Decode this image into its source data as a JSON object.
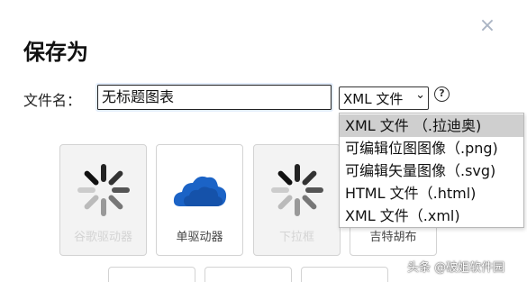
{
  "dialog": {
    "title": "保存为",
    "close_symbol": "×",
    "filename_label": "文件名：",
    "filename_value": "无标题图表",
    "format_selected": "XML 文件",
    "help_symbol": "?"
  },
  "format_options": [
    "XML 文件 （.拉迪奥)",
    "可编辑位图图像（.png)",
    "可编辑矢量图像（.svg)",
    "HTML 文件（.html)",
    "XML 文件（.xml)"
  ],
  "tiles": [
    {
      "label": "谷歌驱动器",
      "icon": "spinner-icon",
      "disabled": true
    },
    {
      "label": "单驱动器",
      "icon": "onedrive-cloud-icon",
      "disabled": false
    },
    {
      "label": "下拉框",
      "icon": "spinner-icon",
      "disabled": true
    },
    {
      "label": "吉特胡布",
      "icon": "",
      "disabled": false
    }
  ],
  "watermark": "头条 @破姐软件园",
  "colors": {
    "onedrive_blue": "#1b63c6",
    "spinner_gray": "#444444"
  }
}
